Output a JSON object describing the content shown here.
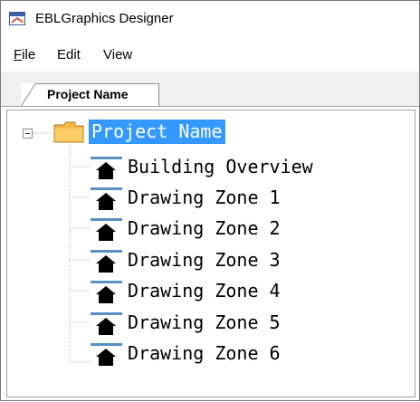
{
  "window": {
    "title": "EBLGraphics Designer",
    "icon": "ebl-app-icon"
  },
  "menu": {
    "file_ul": "F",
    "file_rest": "ile",
    "edit": "Edit",
    "view": "View"
  },
  "tabs": [
    {
      "label": "Project Name",
      "active": true
    }
  ],
  "tree": {
    "root": {
      "label": "Project Name",
      "expanded": true,
      "selected": true,
      "icon": "folder-icon"
    },
    "children": [
      {
        "label": "Building Overview",
        "icon": "house-icon"
      },
      {
        "label": "Drawing Zone 1",
        "icon": "house-icon"
      },
      {
        "label": "Drawing Zone 2",
        "icon": "house-icon"
      },
      {
        "label": "Drawing Zone 3",
        "icon": "house-icon"
      },
      {
        "label": "Drawing Zone 4",
        "icon": "house-icon"
      },
      {
        "label": "Drawing Zone 5",
        "icon": "house-icon"
      },
      {
        "label": "Drawing Zone 6",
        "icon": "house-icon"
      }
    ]
  },
  "colors": {
    "selection": "#3399ff",
    "folder": "#f2b84b"
  }
}
